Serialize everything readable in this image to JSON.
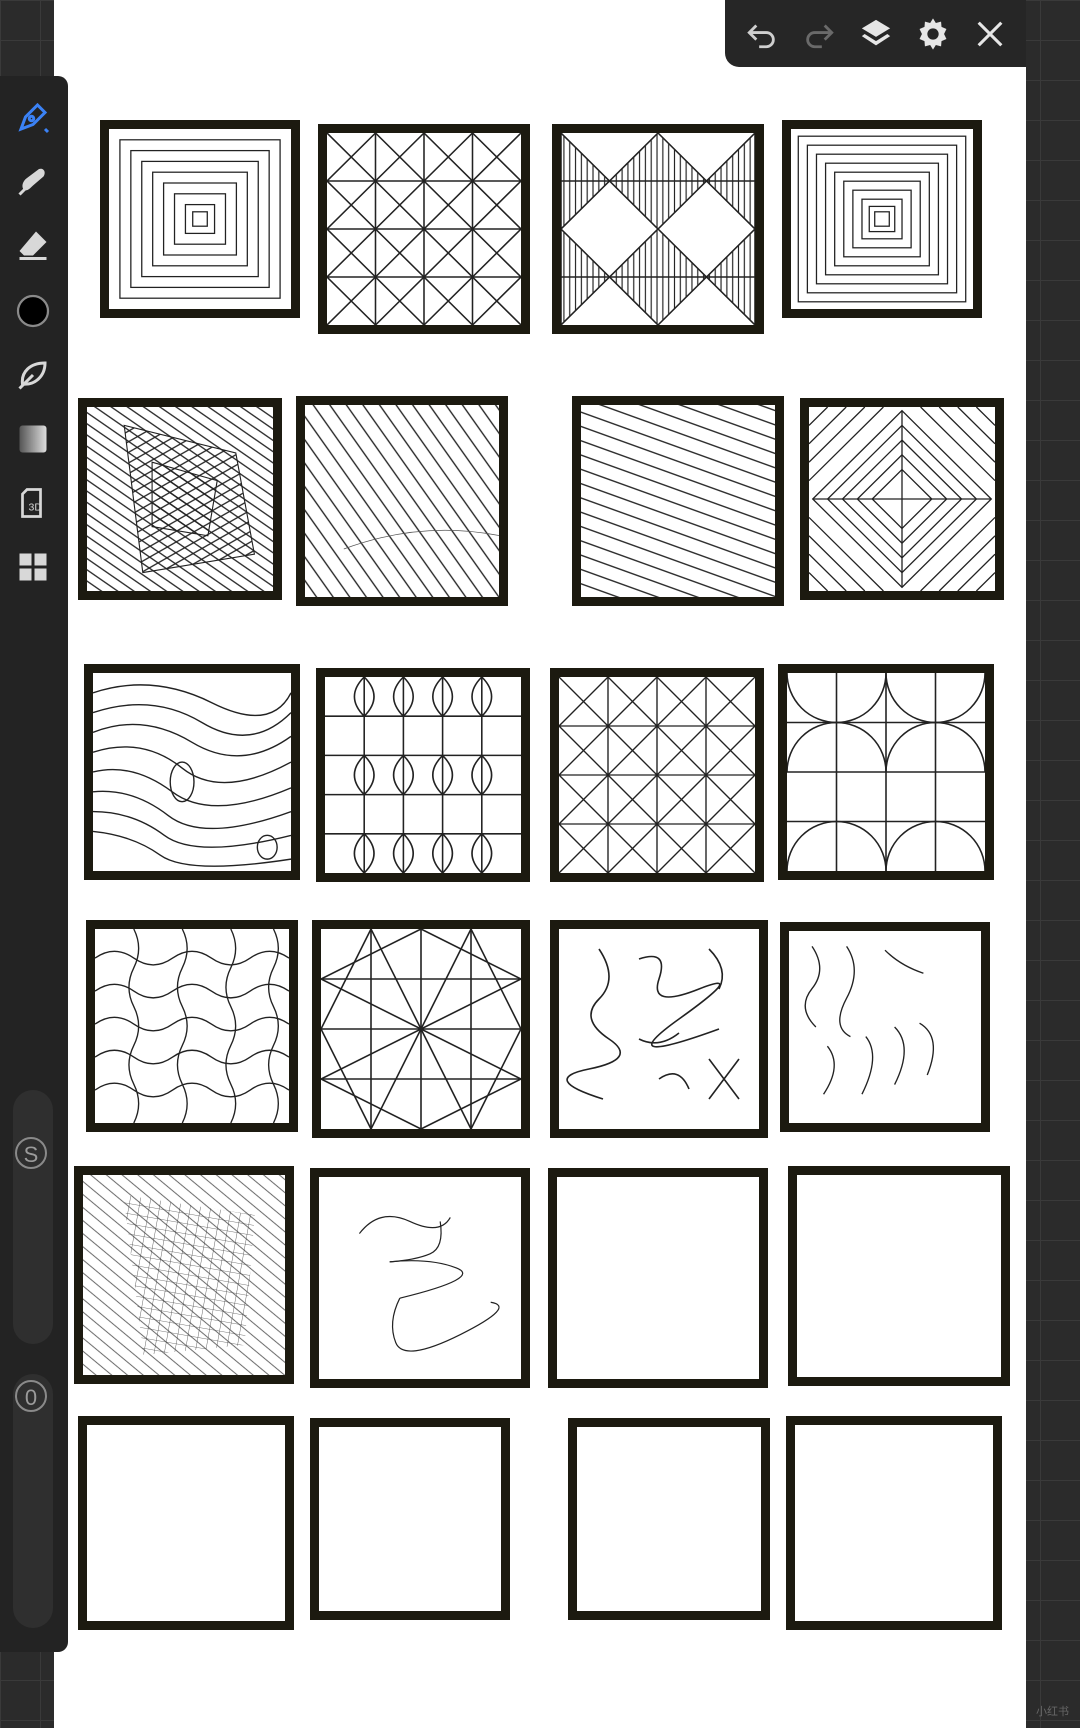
{
  "toolbar_top": {
    "icons": [
      "undo-icon",
      "redo-icon",
      "layers-icon",
      "settings-icon",
      "close-icon"
    ]
  },
  "tools": {
    "icons": [
      "pen-tool-icon",
      "smudge-icon",
      "eraser-icon",
      "color-swatch-icon",
      "leaf-brush-icon",
      "gradient-icon",
      "3d-model-icon",
      "grid-apps-icon"
    ],
    "active_color": "#3b82f6",
    "swatch_color": "#000000"
  },
  "sliders": {
    "size_label": "S",
    "opacity_label": "0"
  },
  "watermark": "小红书"
}
